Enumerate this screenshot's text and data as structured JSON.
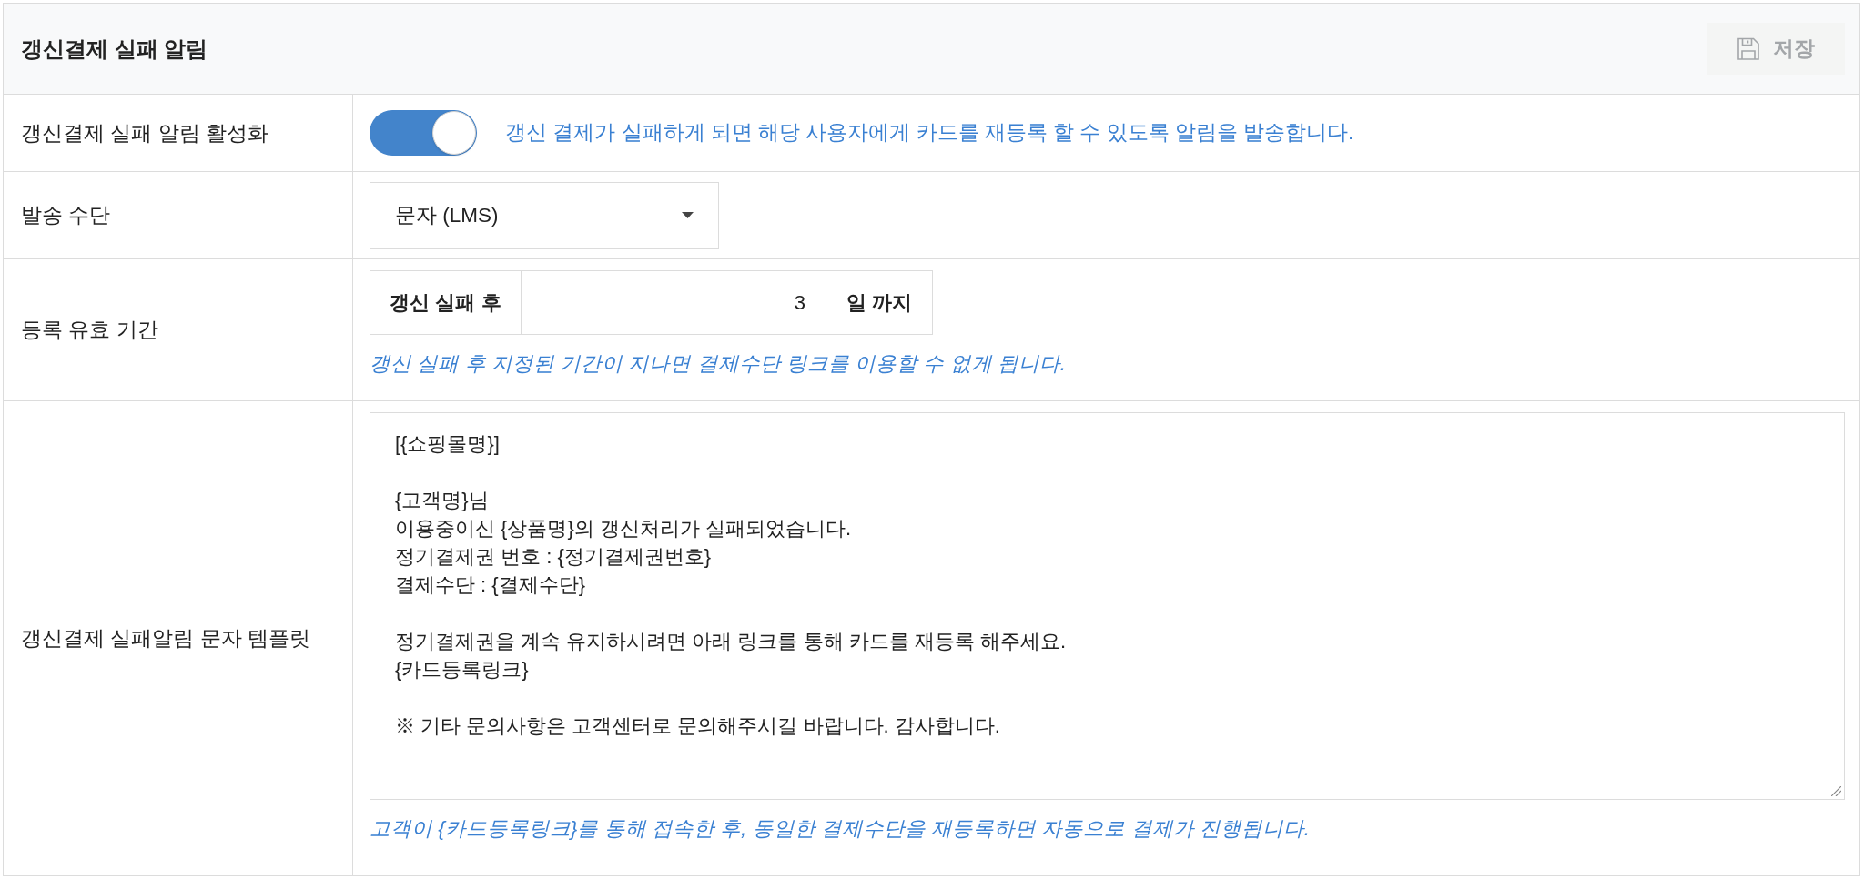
{
  "panel": {
    "title": "갱신결제 실패 알림",
    "save_button": {
      "label": "저장",
      "disabled": true
    }
  },
  "rows": [
    {
      "kind": "toggle",
      "label": "갱신결제 실패 알림 활성화",
      "on": true,
      "description": "갱신 결제가 실패하게 되면 해당 사용자에게 카드를 재등록 할 수 있도록 알림을 발송합니다."
    },
    {
      "kind": "select",
      "label": "발송 수단",
      "value": "문자 (LMS)"
    },
    {
      "kind": "period",
      "label": "등록 유효 기간",
      "prefix": "갱신 실패 후",
      "value": "3",
      "suffix": "일 까지",
      "help": "갱신 실패 후 지정된 기간이 지나면 결제수단 링크를 이용할 수 없게 됩니다."
    },
    {
      "kind": "template",
      "label": "갱신결제 실패알림 문자 템플릿",
      "value": "[{쇼핑몰명}]\n\n{고객명}님\n이용중이신 {상품명}의 갱신처리가 실패되었습니다.\n정기결제권 번호 : {정기결제권번호}\n결제수단 : {결제수단}\n\n정기결제권을 계속 유지하시려면 아래 링크를 통해 카드를 재등록 해주세요.\n{카드등록링크}\n\n※ 기타 문의사항은 고객센터로 문의해주시길 바랍니다. 감사합니다.",
      "help": "고객이 {카드등록링크}를 통해 접속한 후, 동일한 결제수단을 재등록하면 자동으로 결제가 진행됩니다."
    }
  ]
}
